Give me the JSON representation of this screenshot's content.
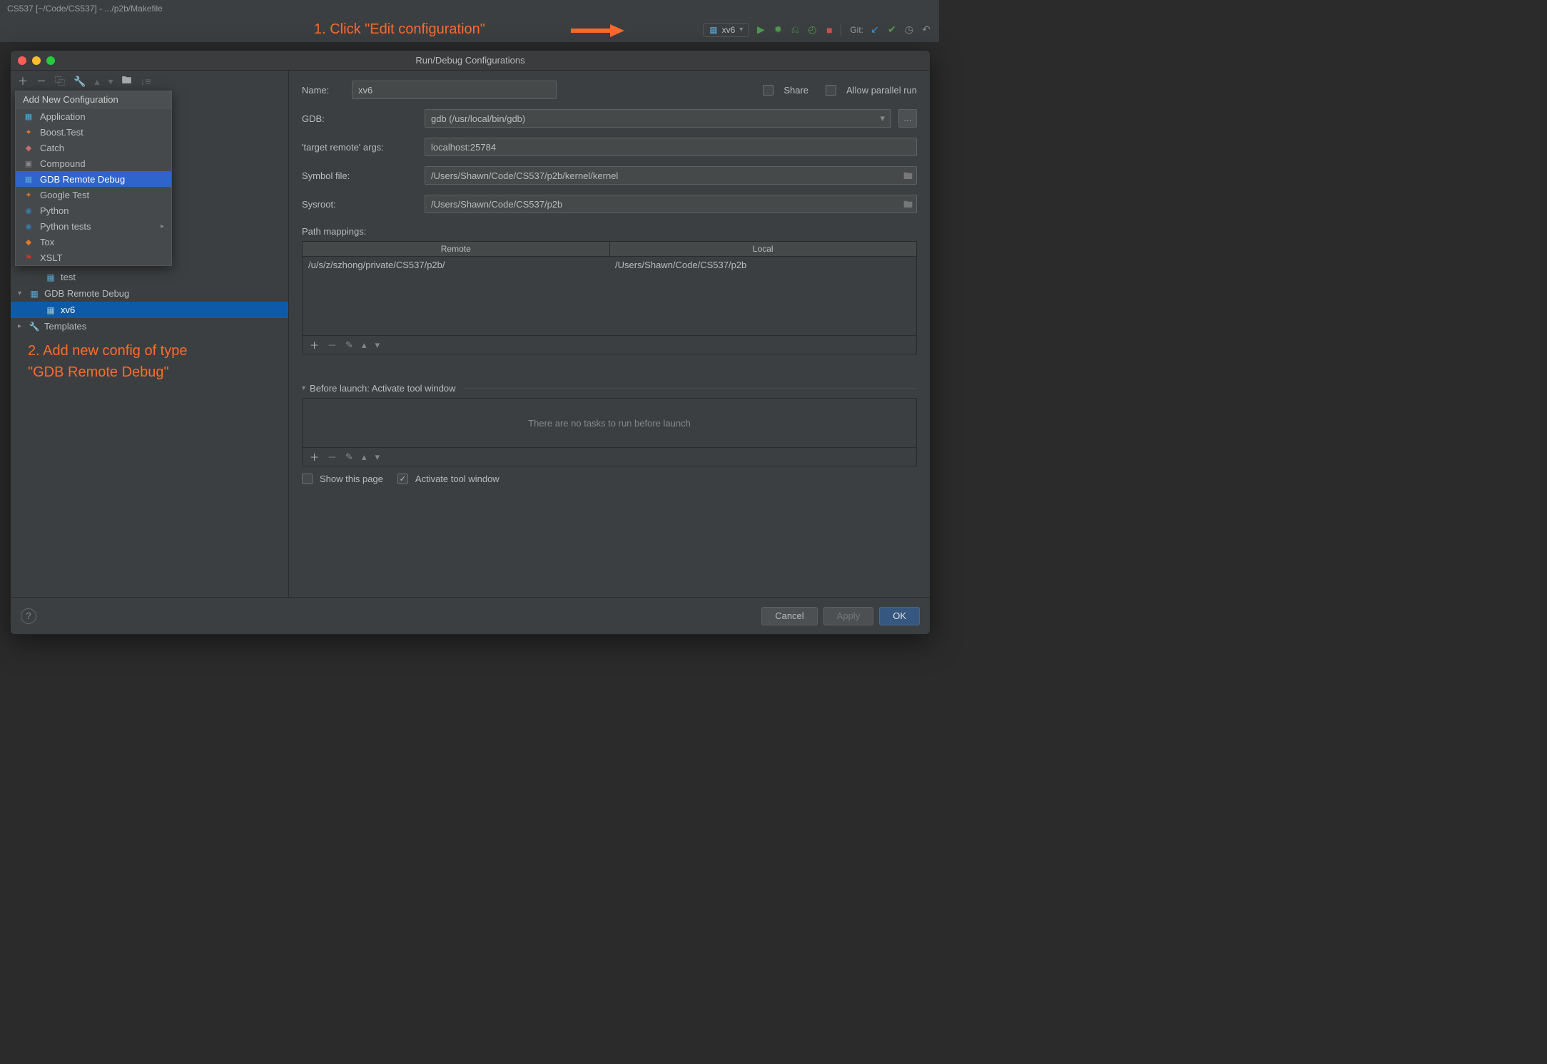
{
  "ide": {
    "titlebar": "CS537 [~/Code/CS537] - .../p2b/Makefile",
    "run_selector": "xv6",
    "git_label": "Git:"
  },
  "annotations": {
    "a1": "1. Click \"Edit configuration\"",
    "a2_line1": "2. Add new config of type",
    "a2_line2": "\"GDB Remote Debug\""
  },
  "dialog": {
    "title": "Run/Debug Configurations",
    "popup": {
      "header": "Add New Configuration",
      "items": [
        {
          "label": "Application",
          "icon": "▦",
          "color": "#5aa7d6"
        },
        {
          "label": "Boost.Test",
          "icon": "✦",
          "color": "#d97a2e"
        },
        {
          "label": "Catch",
          "icon": "◆",
          "color": "#c96b6b"
        },
        {
          "label": "Compound",
          "icon": "▣",
          "color": "#888"
        },
        {
          "label": "GDB Remote Debug",
          "icon": "▦",
          "color": "#5aa7d6",
          "selected": true
        },
        {
          "label": "Google Test",
          "icon": "✦",
          "color": "#d97a2e"
        },
        {
          "label": "Python",
          "icon": "◉",
          "color": "#3b7aa5"
        },
        {
          "label": "Python tests",
          "icon": "◉",
          "color": "#3b7aa5",
          "sub": true
        },
        {
          "label": "Tox",
          "icon": "◆",
          "color": "#d97a2e"
        },
        {
          "label": "XSLT",
          "icon": "⚑",
          "color": "#c0392b"
        }
      ]
    },
    "tree": {
      "test": "test",
      "gdb_remote": "GDB Remote Debug",
      "xv6": "xv6",
      "templates": "Templates"
    },
    "form": {
      "name_label": "Name:",
      "name_value": "xv6",
      "share_label": "Share",
      "parallel_label": "Allow parallel run",
      "gdb_label": "GDB:",
      "gdb_value": "gdb (/usr/local/bin/gdb)",
      "target_label": "'target remote' args:",
      "target_value": "localhost:25784",
      "symbol_label": "Symbol file:",
      "symbol_value": "/Users/Shawn/Code/CS537/p2b/kernel/kernel",
      "sysroot_label": "Sysroot:",
      "sysroot_value": "/Users/Shawn/Code/CS537/p2b",
      "mappings_label": "Path mappings:",
      "mappings_headers": {
        "remote": "Remote",
        "local": "Local"
      },
      "mappings_row": {
        "remote": "/u/s/z/szhong/private/CS537/p2b/",
        "local": "/Users/Shawn/Code/CS537/p2b"
      },
      "before_launch_label": "Before launch: Activate tool window",
      "no_tasks": "There are no tasks to run before launch",
      "show_page": "Show this page",
      "activate_tool": "Activate tool window"
    },
    "footer": {
      "cancel": "Cancel",
      "apply": "Apply",
      "ok": "OK"
    }
  }
}
